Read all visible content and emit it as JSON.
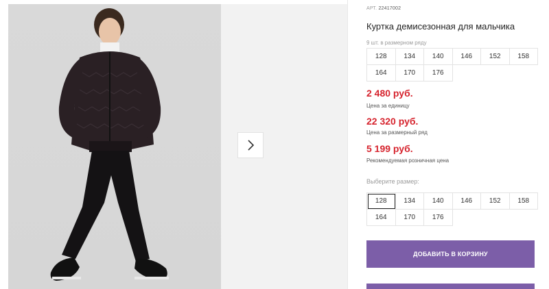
{
  "product": {
    "article_label": "АРТ.",
    "article_number": "22417002",
    "title": "Куртка демисезонная для мальчика",
    "sizes_in_row_note": "9 шт. в размерном ряду",
    "row_sizes": [
      "128",
      "134",
      "140",
      "146",
      "152",
      "158",
      "164",
      "170",
      "176"
    ],
    "prices": [
      {
        "value": "2 480 руб.",
        "label": "Цена за единицу"
      },
      {
        "value": "22 320 руб.",
        "label": "Цена за размерный ряд"
      },
      {
        "value": "5 199 руб.",
        "label": "Рекомендуемая розничная цена"
      }
    ],
    "choose_size_label": "Выберите размер:",
    "select_sizes": [
      "128",
      "134",
      "140",
      "146",
      "152",
      "158",
      "164",
      "170",
      "176"
    ],
    "selected_size": "128",
    "add_to_cart_label": "ДОБАВИТЬ В КОРЗИНУ"
  },
  "gallery": {
    "next_icon": "chevron-right-icon"
  },
  "colors": {
    "price": "#d6242e",
    "button": "#7c5ea8"
  }
}
